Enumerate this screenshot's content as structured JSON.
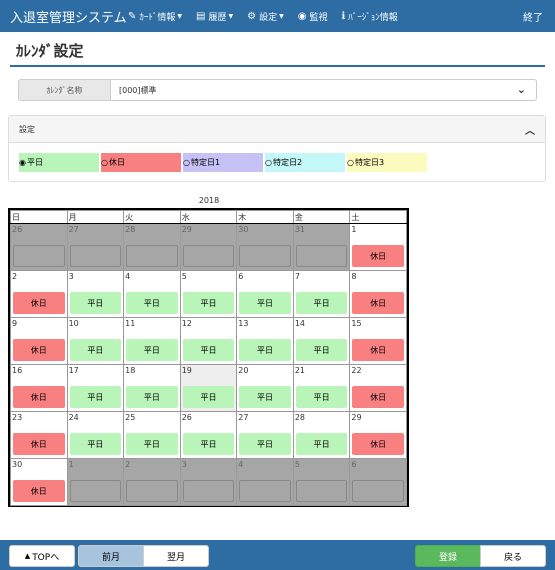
{
  "navbar": {
    "brand": "入退室管理システム",
    "items": [
      {
        "label": "ｶｰﾄﾞ情報",
        "icon": "edit-icon",
        "glyph": "✎"
      },
      {
        "label": "履歴",
        "icon": "list-icon",
        "glyph": "▤"
      },
      {
        "label": "設定",
        "icon": "gear-icon",
        "glyph": "⚙"
      },
      {
        "label": "監視",
        "icon": "eye-icon",
        "glyph": "◉"
      },
      {
        "label": "ﾊﾞｰｼﾞｮﾝ情報",
        "icon": "info-icon",
        "glyph": "ℹ"
      }
    ],
    "exit_label": "終了"
  },
  "page": {
    "title": "ｶﾚﾝﾀﾞ設定"
  },
  "calendar_name": {
    "label": "ｶﾚﾝﾀﾞ名称",
    "value": "[000]標準"
  },
  "settings": {
    "title": "設定",
    "types": [
      {
        "label": "平日",
        "color": "#b9f5b9",
        "selected": true
      },
      {
        "label": "休日",
        "color": "#f98080",
        "selected": false
      },
      {
        "label": "特定日1",
        "color": "#c6c2f5",
        "selected": false
      },
      {
        "label": "特定日2",
        "color": "#c4f7f7",
        "selected": false
      },
      {
        "label": "特定日3",
        "color": "#fbfbbe",
        "selected": false
      }
    ]
  },
  "calendar": {
    "year": "2018",
    "weekdays": [
      "日",
      "月",
      "火",
      "水",
      "木",
      "金",
      "土"
    ],
    "weeks": [
      [
        {
          "d": "26",
          "t": "out"
        },
        {
          "d": "27",
          "t": "out"
        },
        {
          "d": "28",
          "t": "out"
        },
        {
          "d": "29",
          "t": "out"
        },
        {
          "d": "30",
          "t": "out"
        },
        {
          "d": "31",
          "t": "out"
        },
        {
          "d": "1",
          "t": "休日"
        }
      ],
      [
        {
          "d": "2",
          "t": "休日"
        },
        {
          "d": "3",
          "t": "平日"
        },
        {
          "d": "4",
          "t": "平日"
        },
        {
          "d": "5",
          "t": "平日"
        },
        {
          "d": "6",
          "t": "平日"
        },
        {
          "d": "7",
          "t": "平日"
        },
        {
          "d": "8",
          "t": "休日"
        }
      ],
      [
        {
          "d": "9",
          "t": "休日"
        },
        {
          "d": "10",
          "t": "平日"
        },
        {
          "d": "11",
          "t": "平日"
        },
        {
          "d": "12",
          "t": "平日"
        },
        {
          "d": "13",
          "t": "平日"
        },
        {
          "d": "14",
          "t": "平日"
        },
        {
          "d": "15",
          "t": "休日"
        }
      ],
      [
        {
          "d": "16",
          "t": "休日"
        },
        {
          "d": "17",
          "t": "平日"
        },
        {
          "d": "18",
          "t": "平日"
        },
        {
          "d": "19",
          "t": "平日",
          "today": true
        },
        {
          "d": "20",
          "t": "平日"
        },
        {
          "d": "21",
          "t": "平日"
        },
        {
          "d": "22",
          "t": "休日"
        }
      ],
      [
        {
          "d": "23",
          "t": "休日"
        },
        {
          "d": "24",
          "t": "平日"
        },
        {
          "d": "25",
          "t": "平日"
        },
        {
          "d": "26",
          "t": "平日"
        },
        {
          "d": "27",
          "t": "平日"
        },
        {
          "d": "28",
          "t": "平日"
        },
        {
          "d": "29",
          "t": "休日"
        }
      ],
      [
        {
          "d": "30",
          "t": "休日"
        },
        {
          "d": "1",
          "t": "out"
        },
        {
          "d": "2",
          "t": "out"
        },
        {
          "d": "3",
          "t": "out"
        },
        {
          "d": "4",
          "t": "out"
        },
        {
          "d": "5",
          "t": "out"
        },
        {
          "d": "6",
          "t": "out"
        }
      ]
    ]
  },
  "footer": {
    "top_label": "TOPへ",
    "prev_label": "前月",
    "next_label": "翌月",
    "save_label": "登録",
    "back_label": "戻る",
    "save_color": "#5cb85c",
    "prev_color": "#a8c3de"
  },
  "colors": {
    "navbar": "#2e6da4",
    "weekday": "#b9f5b9",
    "holiday": "#f98080"
  }
}
